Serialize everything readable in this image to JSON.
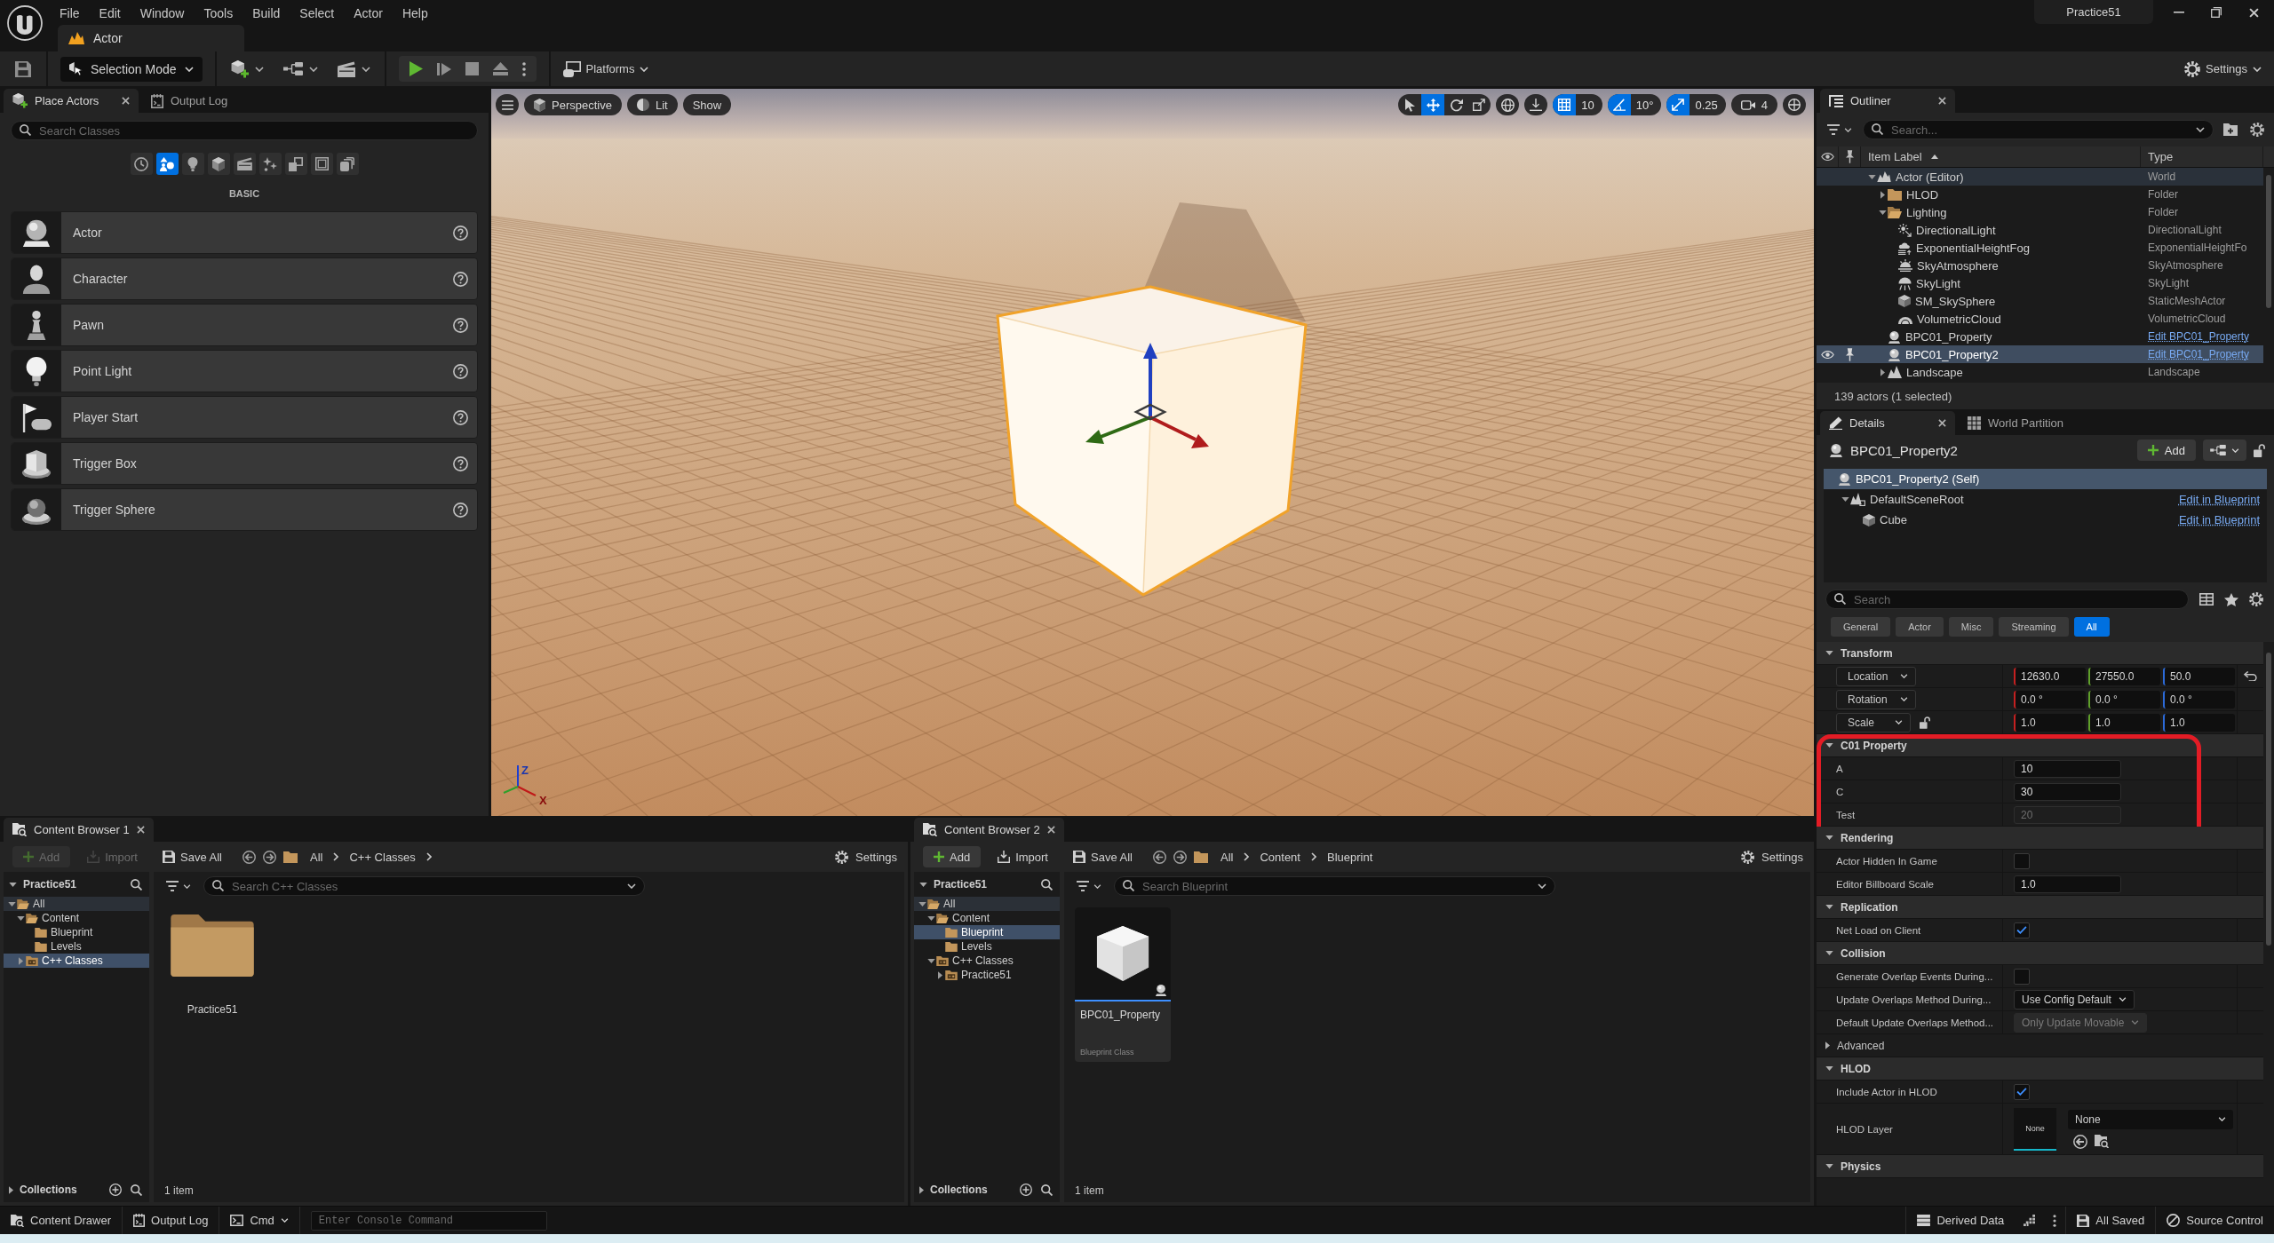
{
  "title_bar": {
    "menu": [
      "File",
      "Edit",
      "Window",
      "Tools",
      "Build",
      "Select",
      "Actor",
      "Help"
    ],
    "level_tab": "Actor",
    "project": "Practice51"
  },
  "toolbar": {
    "mode": "Selection Mode",
    "quick_add": [
      {
        "kind": "add_actor"
      },
      {
        "kind": "blueprint"
      },
      {
        "kind": "cinematic"
      }
    ],
    "play_controls": [
      {
        "kind": "play"
      },
      {
        "kind": "advance"
      },
      {
        "kind": "stop"
      },
      {
        "kind": "eject"
      }
    ],
    "platforms": "Platforms",
    "settings": "Settings"
  },
  "place_actors": {
    "tabs": [
      {
        "label": "Place Actors",
        "kind": "place",
        "selected": true
      },
      {
        "label": "Output Log",
        "kind": "log",
        "selected": false
      }
    ],
    "search": {
      "placeholder": "Search Classes"
    },
    "categories": [
      {
        "kind": "recent",
        "selected": false
      },
      {
        "kind": "basic",
        "selected": true
      },
      {
        "kind": "lights",
        "selected": false
      },
      {
        "kind": "shapes",
        "selected": false
      },
      {
        "kind": "cinematic",
        "selected": false
      },
      {
        "kind": "effects",
        "selected": false
      },
      {
        "kind": "volumes",
        "selected": false
      },
      {
        "kind": "classes",
        "selected": false
      },
      {
        "kind": "stack",
        "selected": false
      }
    ],
    "heading": "BASIC",
    "items": [
      {
        "label": "Actor",
        "kind": "actor"
      },
      {
        "label": "Character",
        "kind": "character"
      },
      {
        "label": "Pawn",
        "kind": "pawn"
      },
      {
        "label": "Point Light",
        "kind": "point_light"
      },
      {
        "label": "Player Start",
        "kind": "player_start"
      },
      {
        "label": "Trigger Box",
        "kind": "trigger_box"
      },
      {
        "label": "Trigger Sphere",
        "kind": "trigger_sphere"
      }
    ]
  },
  "viewport": {
    "view_buttons": [
      {
        "label": "Perspective",
        "kind": "perspective"
      },
      {
        "label": "Lit",
        "kind": "lit"
      },
      {
        "label": "Show",
        "kind": "show"
      }
    ],
    "transform_tools": [
      {
        "kind": "select",
        "selected": false
      },
      {
        "kind": "translate",
        "selected": true
      },
      {
        "kind": "rotate",
        "selected": false
      },
      {
        "kind": "scale",
        "selected": false
      }
    ],
    "snaps": [
      {
        "kind": "grid",
        "on": true,
        "value": "10"
      },
      {
        "kind": "rotation",
        "on": true,
        "value": "10°"
      },
      {
        "kind": "scale",
        "on": true,
        "value": "0.25"
      }
    ],
    "camera_speed": "4",
    "axis_labels": [
      "Z",
      "X"
    ]
  },
  "outliner": {
    "tab": "Outliner",
    "search": {
      "placeholder": "Search..."
    },
    "columns": [
      "Item Label",
      "Type"
    ],
    "rows": [
      {
        "label": "Actor (Editor)",
        "type": "World",
        "kind": "world",
        "type_link": false,
        "selected": false,
        "expanded": true,
        "children": [
          {
            "label": "HLOD",
            "type": "Folder",
            "kind": "folder",
            "type_link": false,
            "selected": false,
            "expanded": false
          },
          {
            "label": "Lighting",
            "type": "Folder",
            "kind": "folder",
            "type_link": false,
            "selected": false,
            "expanded": true,
            "children": [
              {
                "label": "DirectionalLight",
                "type": "DirectionalLight",
                "kind": "directional_light",
                "type_link": false,
                "selected": false
              },
              {
                "label": "ExponentialHeightFog",
                "type": "ExponentialHeightFo",
                "kind": "fog",
                "type_link": false,
                "selected": false
              },
              {
                "label": "SkyAtmosphere",
                "type": "SkyAtmosphere",
                "kind": "sky_atmosphere",
                "type_link": false,
                "selected": false
              },
              {
                "label": "SkyLight",
                "type": "SkyLight",
                "kind": "sky_light",
                "type_link": false,
                "selected": false
              },
              {
                "label": "SM_SkySphere",
                "type": "StaticMeshActor",
                "kind": "mesh",
                "type_link": false,
                "selected": false
              },
              {
                "label": "VolumetricCloud",
                "type": "VolumetricCloud",
                "kind": "cloud",
                "type_link": false,
                "selected": false
              }
            ]
          },
          {
            "label": "BPC01_Property",
            "type": "Edit BPC01_Property",
            "kind": "actor",
            "type_link": true,
            "selected": false
          },
          {
            "label": "BPC01_Property2",
            "type": "Edit BPC01_Property",
            "kind": "actor",
            "type_link": true,
            "selected": true
          },
          {
            "label": "Landscape",
            "type": "Landscape",
            "kind": "landscape",
            "type_link": false,
            "selected": false,
            "expanded": false
          }
        ]
      }
    ],
    "status": "139 actors (1 selected)"
  },
  "details": {
    "tabs": [
      {
        "label": "Details",
        "kind": "details",
        "selected": true
      },
      {
        "label": "World Partition",
        "kind": "world_partition",
        "selected": false
      }
    ],
    "actor": {
      "name": "BPC01_Property2",
      "add": "Add"
    },
    "components": [
      {
        "label": "BPC01_Property2 (Self)",
        "kind": "actor",
        "selected": true,
        "children": [
          {
            "label": "DefaultSceneRoot",
            "kind": "scene_root",
            "selected": false,
            "expanded": true,
            "link": "Edit in Blueprint",
            "children": [
              {
                "label": "Cube",
                "kind": "mesh",
                "selected": false,
                "link": "Edit in Blueprint"
              }
            ]
          }
        ]
      }
    ],
    "search": {
      "placeholder": "Search"
    },
    "filters": [
      {
        "label": "General",
        "selected": false
      },
      {
        "label": "Actor",
        "selected": false
      },
      {
        "label": "Misc",
        "selected": false
      },
      {
        "label": "Streaming",
        "selected": false
      },
      {
        "label": "All",
        "selected": true
      }
    ],
    "sections": [
      {
        "title": "Transform",
        "expanded": true,
        "rows": [
          {
            "kind": "vector",
            "label": "Location",
            "values": [
              "12630.0",
              "27550.0",
              "50.0"
            ],
            "resettable": true
          },
          {
            "kind": "vector",
            "label": "Rotation",
            "values": [
              "0.0 °",
              "0.0 °",
              "0.0 °"
            ]
          },
          {
            "kind": "vector",
            "label": "Scale",
            "values": [
              "1.0",
              "1.0",
              "1.0"
            ],
            "locked": false
          }
        ]
      },
      {
        "title": "C01 Property",
        "expanded": true,
        "highlighted": true,
        "rows": [
          {
            "kind": "number",
            "label": "A",
            "value": "10",
            "disabled": false
          },
          {
            "kind": "number",
            "label": "C",
            "value": "30",
            "disabled": false
          },
          {
            "kind": "number",
            "label": "Test",
            "value": "20",
            "disabled": true
          }
        ]
      },
      {
        "title": "Rendering",
        "expanded": true,
        "rows": [
          {
            "kind": "checkbox",
            "label": "Actor Hidden In Game",
            "checked": false
          },
          {
            "kind": "number",
            "label": "Editor Billboard Scale",
            "value": "1.0",
            "disabled": false
          }
        ]
      },
      {
        "title": "Replication",
        "expanded": true,
        "rows": [
          {
            "kind": "checkbox",
            "label": "Net Load on Client",
            "checked": true
          }
        ]
      },
      {
        "title": "Collision",
        "expanded": true,
        "rows": [
          {
            "kind": "checkbox",
            "label": "Generate Overlap Events During...",
            "checked": false
          },
          {
            "kind": "dropdown",
            "label": "Update Overlaps Method During...",
            "value": "Use Config Default",
            "disabled": false
          },
          {
            "kind": "dropdown",
            "label": "Default Update Overlaps Method...",
            "value": "Only Update Movable",
            "disabled": true
          },
          {
            "kind": "group",
            "label": "Advanced",
            "expanded": false
          }
        ]
      },
      {
        "title": "HLOD",
        "expanded": true,
        "rows": [
          {
            "kind": "checkbox",
            "label": "Include Actor in HLOD",
            "checked": true
          },
          {
            "kind": "asset",
            "label": "HLOD Layer",
            "thumbnail": "None",
            "value": "None"
          }
        ]
      },
      {
        "title": "Physics",
        "expanded": true
      }
    ]
  },
  "content_browsers": [
    {
      "tab": "Content Browser 1",
      "buttons": [
        {
          "label": "Add",
          "kind": "add",
          "disabled": true
        },
        {
          "label": "Import",
          "kind": "import",
          "disabled": true
        },
        {
          "label": "Save All",
          "kind": "save",
          "disabled": false
        }
      ],
      "path": [
        "All",
        "C++ Classes"
      ],
      "path_more": true,
      "settings": "Settings",
      "sources": {
        "title": "Practice51",
        "expanded": true,
        "tree": [
          {
            "label": "All",
            "kind": "root",
            "selected": false,
            "expanded": true,
            "children": [
              {
                "label": "Content",
                "kind": "folder",
                "selected": false,
                "expanded": true,
                "children": [
                  {
                    "label": "Blueprint",
                    "kind": "folder",
                    "selected": false
                  },
                  {
                    "label": "Levels",
                    "kind": "folder",
                    "selected": false
                  }
                ]
              },
              {
                "label": "C++ Classes",
                "kind": "code",
                "selected": true,
                "expanded": false
              }
            ]
          }
        ]
      },
      "collections": {
        "title": "Collections",
        "expanded": false
      },
      "search": {
        "placeholder": "Search C++ Classes"
      },
      "assets": [
        {
          "label": "Practice51",
          "kind": "folder"
        }
      ],
      "count": "1 item"
    },
    {
      "tab": "Content Browser 2",
      "buttons": [
        {
          "label": "Add",
          "kind": "add",
          "disabled": false
        },
        {
          "label": "Import",
          "kind": "import",
          "disabled": false
        },
        {
          "label": "Save All",
          "kind": "save",
          "disabled": false
        }
      ],
      "path": [
        "All",
        "Content",
        "Blueprint"
      ],
      "settings": "Settings",
      "sources": {
        "title": "Practice51",
        "expanded": true,
        "tree": [
          {
            "label": "All",
            "kind": "root",
            "selected": false,
            "expanded": true,
            "children": [
              {
                "label": "Content",
                "kind": "folder",
                "selected": false,
                "expanded": true,
                "children": [
                  {
                    "label": "Blueprint",
                    "kind": "folder",
                    "selected": true
                  },
                  {
                    "label": "Levels",
                    "kind": "folder",
                    "selected": false
                  }
                ]
              },
              {
                "label": "C++ Classes",
                "kind": "code",
                "selected": false,
                "expanded": true,
                "children": [
                  {
                    "label": "Practice51",
                    "kind": "code",
                    "selected": false,
                    "expanded": false
                  }
                ]
              }
            ]
          }
        ]
      },
      "collections": {
        "title": "Collections",
        "expanded": false
      },
      "search": {
        "placeholder": "Search Blueprint"
      },
      "assets": [
        {
          "label": "BPC01_Property",
          "kind": "blueprint",
          "subtitle": "Blueprint Class"
        }
      ],
      "count": "1 item"
    }
  ],
  "status_bar": {
    "left": [
      {
        "label": "Content Drawer",
        "kind": "drawer"
      },
      {
        "label": "Output Log",
        "kind": "log"
      },
      {
        "label": "Cmd",
        "kind": "cmd"
      }
    ],
    "console": {
      "placeholder": "Enter Console Command"
    },
    "right": [
      {
        "label": "Derived Data",
        "kind": "derived"
      },
      {
        "label": "All Saved",
        "kind": "saved"
      },
      {
        "label": "Source Control",
        "kind": "source_control"
      }
    ]
  }
}
